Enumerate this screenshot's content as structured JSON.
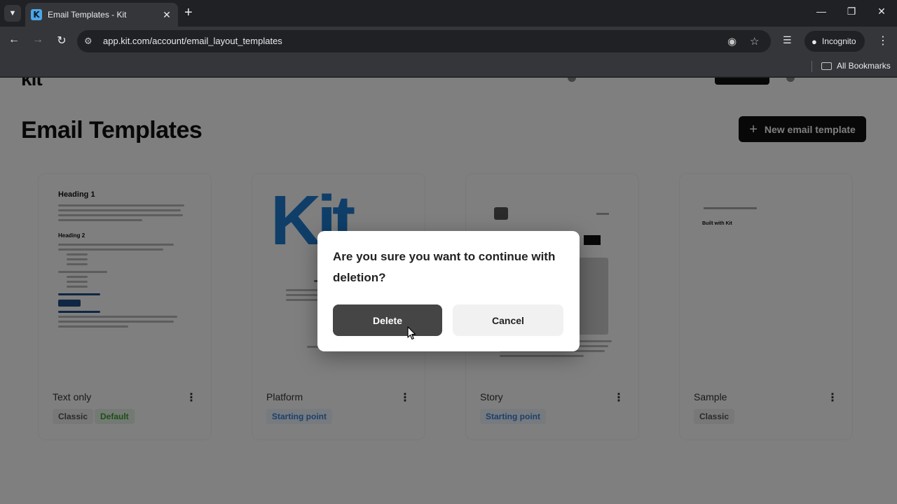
{
  "browser": {
    "tab_title": "Email Templates - Kit",
    "favicon_letter": "K",
    "url": "app.kit.com/account/email_layout_templates",
    "incognito_label": "Incognito",
    "bookmarks_label": "All Bookmarks"
  },
  "page": {
    "title": "Email Templates",
    "new_template_label": "New email template"
  },
  "templates": [
    {
      "name": "Text only",
      "badges": [
        "Classic",
        "Default"
      ]
    },
    {
      "name": "Platform",
      "badges": [
        "Starting point"
      ]
    },
    {
      "name": "Story",
      "badges": [
        "Starting point"
      ]
    },
    {
      "name": "Sample",
      "badges": [
        "Classic"
      ]
    }
  ],
  "thumbnails": {
    "text_only_h1": "Heading 1",
    "text_only_h2": "Heading 2",
    "platform_logo": "Kit",
    "sample_footer": "Built with Kit"
  },
  "dialog": {
    "message": "Are you sure you want to continue with deletion?",
    "delete_label": "Delete",
    "cancel_label": "Cancel"
  },
  "colors": {
    "overlay": "#00000080",
    "delete_button": "#454545",
    "cancel_button": "#f1f1f1",
    "kit_blue": "#1f7fd3"
  }
}
